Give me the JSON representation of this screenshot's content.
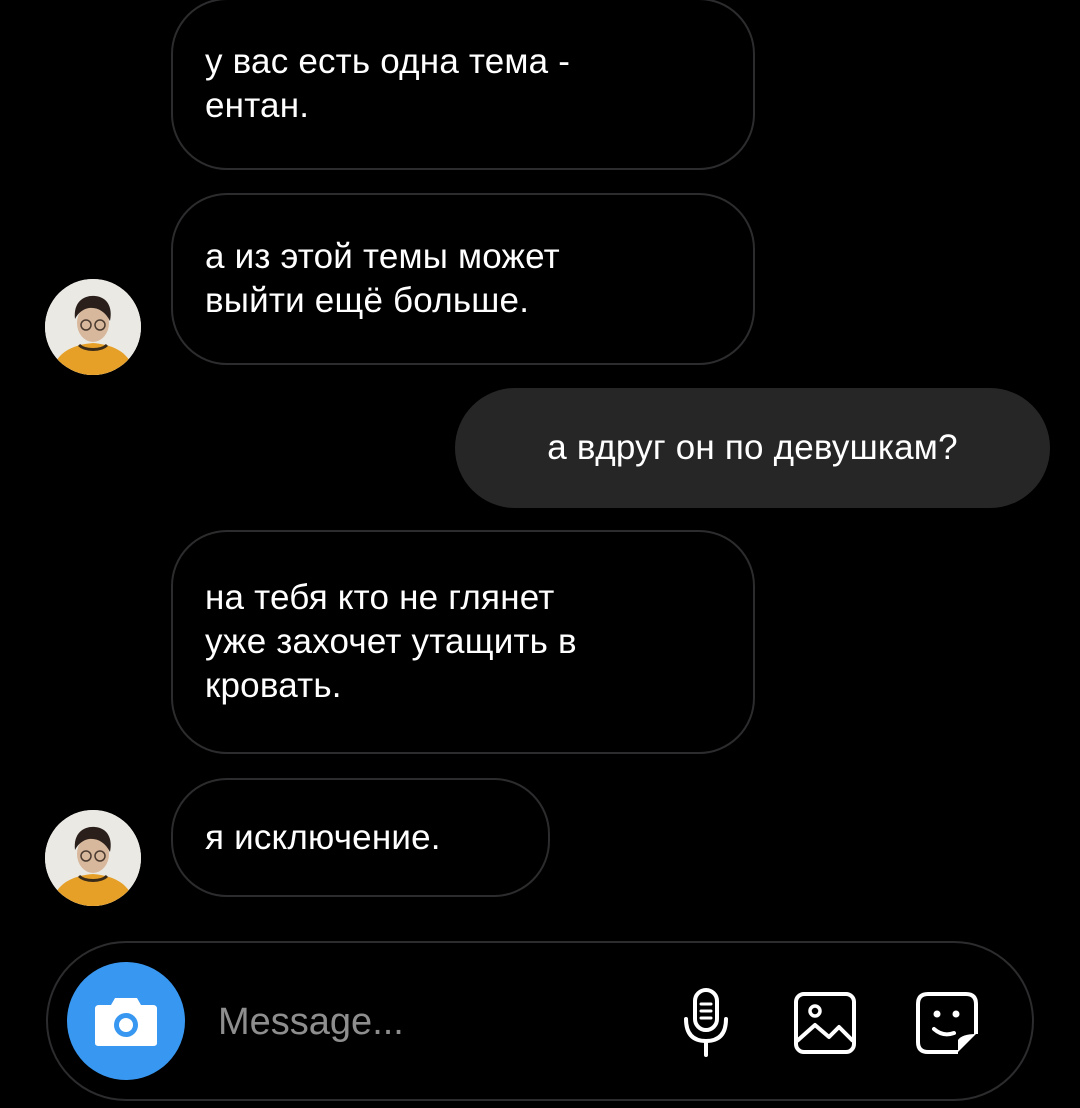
{
  "colors": {
    "background": "#000000",
    "incoming_border": "#2c2c2e",
    "outgoing_bubble": "#262626",
    "camera_button": "#3897f0",
    "placeholder": "#8e8e8e"
  },
  "messages": [
    {
      "direction": "incoming",
      "text": "у вас есть одна тема -\nентан.",
      "show_avatar": false
    },
    {
      "direction": "incoming",
      "text": "а из этой темы может\nвыйти ещё больше.",
      "show_avatar": true
    },
    {
      "direction": "outgoing",
      "text": "а вдруг он по девушкам?",
      "show_avatar": false
    },
    {
      "direction": "incoming",
      "text": "на тебя кто не глянет\nуже захочет утащить в\nкровать.",
      "show_avatar": false
    },
    {
      "direction": "incoming",
      "text": "я исключение.",
      "show_avatar": true
    }
  ],
  "composer": {
    "placeholder": "Message...",
    "icons": [
      "camera-icon",
      "microphone-icon",
      "gallery-icon",
      "sticker-icon"
    ]
  }
}
